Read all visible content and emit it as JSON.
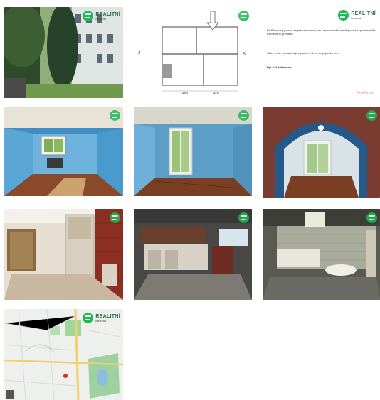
{
  "brand": {
    "name": "REALITNÍ",
    "subtitle": "kancelář",
    "accent": "#1db954"
  },
  "floorplan": {
    "west_label": "J",
    "east_label": "S"
  },
  "document": {
    "line1": "Ve Přípravný prostor se plánuje změna cen, nemovitost bude dispozičně upravena dle uvedeného přehledu",
    "line2": "Sklep bude součástí bytu, plocha 2,5 m² za příplatek ceny",
    "line3": "Byt 3+1 k dispozici",
    "watermark": "RealiGroup"
  },
  "gallery": {
    "items": [
      {
        "name": "building-exterior-photo"
      },
      {
        "name": "floor-plan-image"
      },
      {
        "name": "info-document-image"
      },
      {
        "name": "blue-room-window-photo"
      },
      {
        "name": "room-balcony-door-photo"
      },
      {
        "name": "archway-room-photo"
      },
      {
        "name": "hallway-wardrobe-photo"
      },
      {
        "name": "kitchen-photo"
      },
      {
        "name": "bathroom-photo"
      },
      {
        "name": "location-map-image"
      }
    ]
  }
}
